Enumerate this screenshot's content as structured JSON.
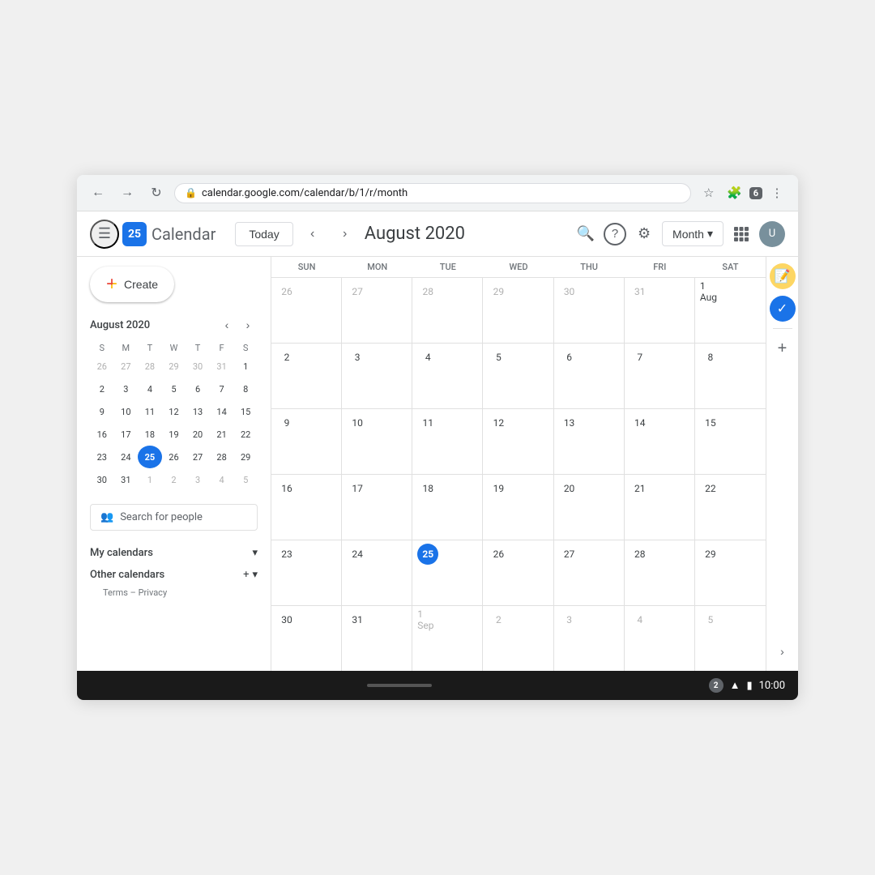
{
  "browser": {
    "url": "calendar.google.com/calendar/b/1/r/month",
    "extension_badge": "6"
  },
  "header": {
    "menu_label": "☰",
    "logo_date": "25",
    "app_name": "Calendar",
    "today_label": "Today",
    "month_title": "August 2020",
    "view_label": "Month",
    "search_icon": "🔍",
    "help_icon": "?",
    "settings_icon": "⚙"
  },
  "sidebar": {
    "create_label": "Create",
    "mini_cal_title": "August 2020",
    "mini_cal_headers": [
      "S",
      "M",
      "T",
      "W",
      "T",
      "F",
      "S"
    ],
    "mini_cal_weeks": [
      [
        {
          "day": "26",
          "other": true
        },
        {
          "day": "27",
          "other": true
        },
        {
          "day": "28",
          "other": true
        },
        {
          "day": "29",
          "other": true
        },
        {
          "day": "30",
          "other": true
        },
        {
          "day": "31",
          "other": true
        },
        {
          "day": "1",
          "other": false
        }
      ],
      [
        {
          "day": "2",
          "other": false
        },
        {
          "day": "3",
          "other": false
        },
        {
          "day": "4",
          "other": false
        },
        {
          "day": "5",
          "other": false
        },
        {
          "day": "6",
          "other": false
        },
        {
          "day": "7",
          "other": false
        },
        {
          "day": "8",
          "other": false
        }
      ],
      [
        {
          "day": "9",
          "other": false
        },
        {
          "day": "10",
          "other": false
        },
        {
          "day": "11",
          "other": false
        },
        {
          "day": "12",
          "other": false
        },
        {
          "day": "13",
          "other": false
        },
        {
          "day": "14",
          "other": false
        },
        {
          "day": "15",
          "other": false
        }
      ],
      [
        {
          "day": "16",
          "other": false
        },
        {
          "day": "17",
          "other": false
        },
        {
          "day": "18",
          "other": false
        },
        {
          "day": "19",
          "other": false
        },
        {
          "day": "20",
          "other": false
        },
        {
          "day": "21",
          "other": false
        },
        {
          "day": "22",
          "other": false
        }
      ],
      [
        {
          "day": "23",
          "other": false
        },
        {
          "day": "24",
          "other": false
        },
        {
          "day": "25",
          "today": true
        },
        {
          "day": "26",
          "other": false
        },
        {
          "day": "27",
          "other": false
        },
        {
          "day": "28",
          "other": false
        },
        {
          "day": "29",
          "other": false
        }
      ],
      [
        {
          "day": "30",
          "other": false
        },
        {
          "day": "31",
          "other": false
        },
        {
          "day": "1",
          "other": true
        },
        {
          "day": "2",
          "other": true
        },
        {
          "day": "3",
          "other": true
        },
        {
          "day": "4",
          "other": true
        },
        {
          "day": "5",
          "other": true
        }
      ]
    ],
    "search_people_placeholder": "Search for people",
    "my_calendars_label": "My calendars",
    "other_calendars_label": "Other calendars",
    "terms_label": "Terms",
    "privacy_label": "Privacy",
    "terms_separator": "–"
  },
  "calendar": {
    "day_headers": [
      {
        "label": "SUN"
      },
      {
        "label": "MON"
      },
      {
        "label": "TUE"
      },
      {
        "label": "WED"
      },
      {
        "label": "THU"
      },
      {
        "label": "FRI"
      },
      {
        "label": "SAT"
      }
    ],
    "weeks": [
      [
        {
          "day": "26",
          "other": true
        },
        {
          "day": "27",
          "other": true
        },
        {
          "day": "28",
          "other": true
        },
        {
          "day": "29",
          "other": true
        },
        {
          "day": "30",
          "other": true
        },
        {
          "day": "31",
          "other": true
        },
        {
          "day": "1 Aug",
          "other": false,
          "sat": true
        }
      ],
      [
        {
          "day": "2"
        },
        {
          "day": "3"
        },
        {
          "day": "4"
        },
        {
          "day": "5"
        },
        {
          "day": "6"
        },
        {
          "day": "7"
        },
        {
          "day": "8"
        }
      ],
      [
        {
          "day": "9"
        },
        {
          "day": "10"
        },
        {
          "day": "11"
        },
        {
          "day": "12"
        },
        {
          "day": "13"
        },
        {
          "day": "14"
        },
        {
          "day": "15"
        }
      ],
      [
        {
          "day": "16"
        },
        {
          "day": "17"
        },
        {
          "day": "18"
        },
        {
          "day": "19"
        },
        {
          "day": "20"
        },
        {
          "day": "21"
        },
        {
          "day": "22"
        }
      ],
      [
        {
          "day": "23"
        },
        {
          "day": "24"
        },
        {
          "day": "25",
          "today": true
        },
        {
          "day": "26"
        },
        {
          "day": "27"
        },
        {
          "day": "28"
        },
        {
          "day": "29"
        }
      ],
      [
        {
          "day": "30"
        },
        {
          "day": "31"
        },
        {
          "day": "1 Sep",
          "other": true
        },
        {
          "day": "2",
          "other": true
        },
        {
          "day": "3",
          "other": true
        },
        {
          "day": "4",
          "other": true
        },
        {
          "day": "5",
          "other": true
        }
      ]
    ]
  },
  "status_bar": {
    "notification_count": "2",
    "time": "10:00"
  }
}
